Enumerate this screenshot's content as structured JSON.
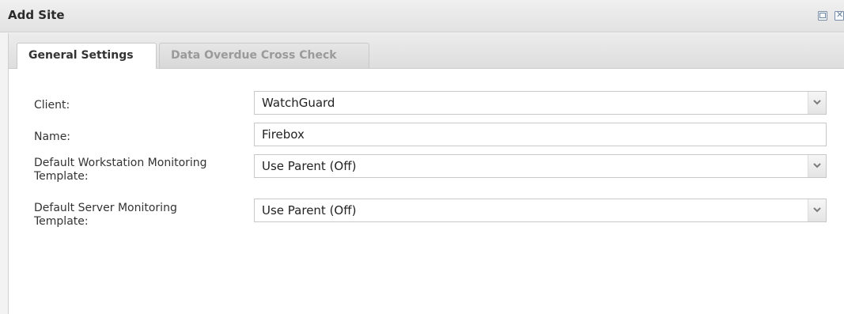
{
  "window": {
    "title": "Add Site"
  },
  "tabs": [
    {
      "label": "General Settings",
      "active": true
    },
    {
      "label": "Data Overdue Cross Check",
      "active": false
    }
  ],
  "form": {
    "client": {
      "label": "Client:",
      "value": "WatchGuard"
    },
    "name": {
      "label": "Name:",
      "value": "Firebox"
    },
    "workstation_template": {
      "label_line1": "Default Workstation Monitoring",
      "label_line2": "Template:",
      "value": "Use Parent (Off)"
    },
    "server_template": {
      "label_line1": "Default Server Monitoring",
      "label_line2": "Template:",
      "value": "Use Parent (Off)"
    }
  },
  "icons": {
    "maximize": "maximize-icon",
    "close": "close-icon",
    "dropdown": "chevron-down-icon"
  }
}
